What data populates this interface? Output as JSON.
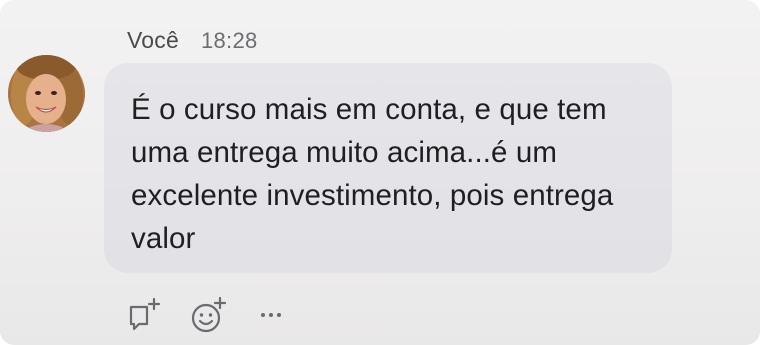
{
  "message": {
    "sender": "Você",
    "time": "18:28",
    "text": "É o curso mais em conta, e que tem uma entrega muito acima...é um excelente investimento, pois entrega valor"
  },
  "avatar": {
    "icon": "profile-photo"
  },
  "actions": [
    {
      "icon": "add-reply-icon"
    },
    {
      "icon": "add-reaction-icon"
    },
    {
      "icon": "more-options-icon"
    }
  ],
  "colors": {
    "bubble": "#e3e3e8",
    "background": "#f1f0f0",
    "text": "#1f1f21",
    "meta_text": "#5a595c",
    "icon": "#6a6a70"
  }
}
